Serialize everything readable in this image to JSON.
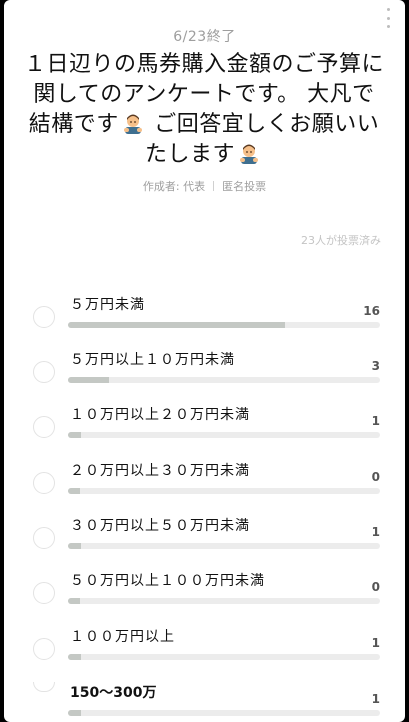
{
  "poll": {
    "end_date": "6/23終了",
    "title_parts": [
      "１日辺りの馬券購入金額のご予算に関してのアンケートです。 大凡で結構です",
      " ご回答宜しくお願いいたします"
    ],
    "emoji_icon": "person-bowing-icon",
    "author": "作成者: 代表",
    "anonymous": "匿名投票",
    "voters": "23人が投票済み",
    "total_votes": 23,
    "options": [
      {
        "label": "５万円未満",
        "votes": "16",
        "share": 0.696
      },
      {
        "label": "５万円以上１０万円未満",
        "votes": "3",
        "share": 0.13
      },
      {
        "label": "１０万円以上２０万円未満",
        "votes": "1",
        "share": 0.043
      },
      {
        "label": "２０万円以上３０万円未満",
        "votes": "0",
        "share": 0.0
      },
      {
        "label": "３０万円以上５０万円未満",
        "votes": "1",
        "share": 0.043
      },
      {
        "label": "５０万円以上１００万円未満",
        "votes": "0",
        "share": 0.0
      },
      {
        "label": "１００万円以上",
        "votes": "1",
        "share": 0.043
      },
      {
        "label": "150〜300万",
        "votes": "1",
        "share": 0.043
      }
    ]
  }
}
